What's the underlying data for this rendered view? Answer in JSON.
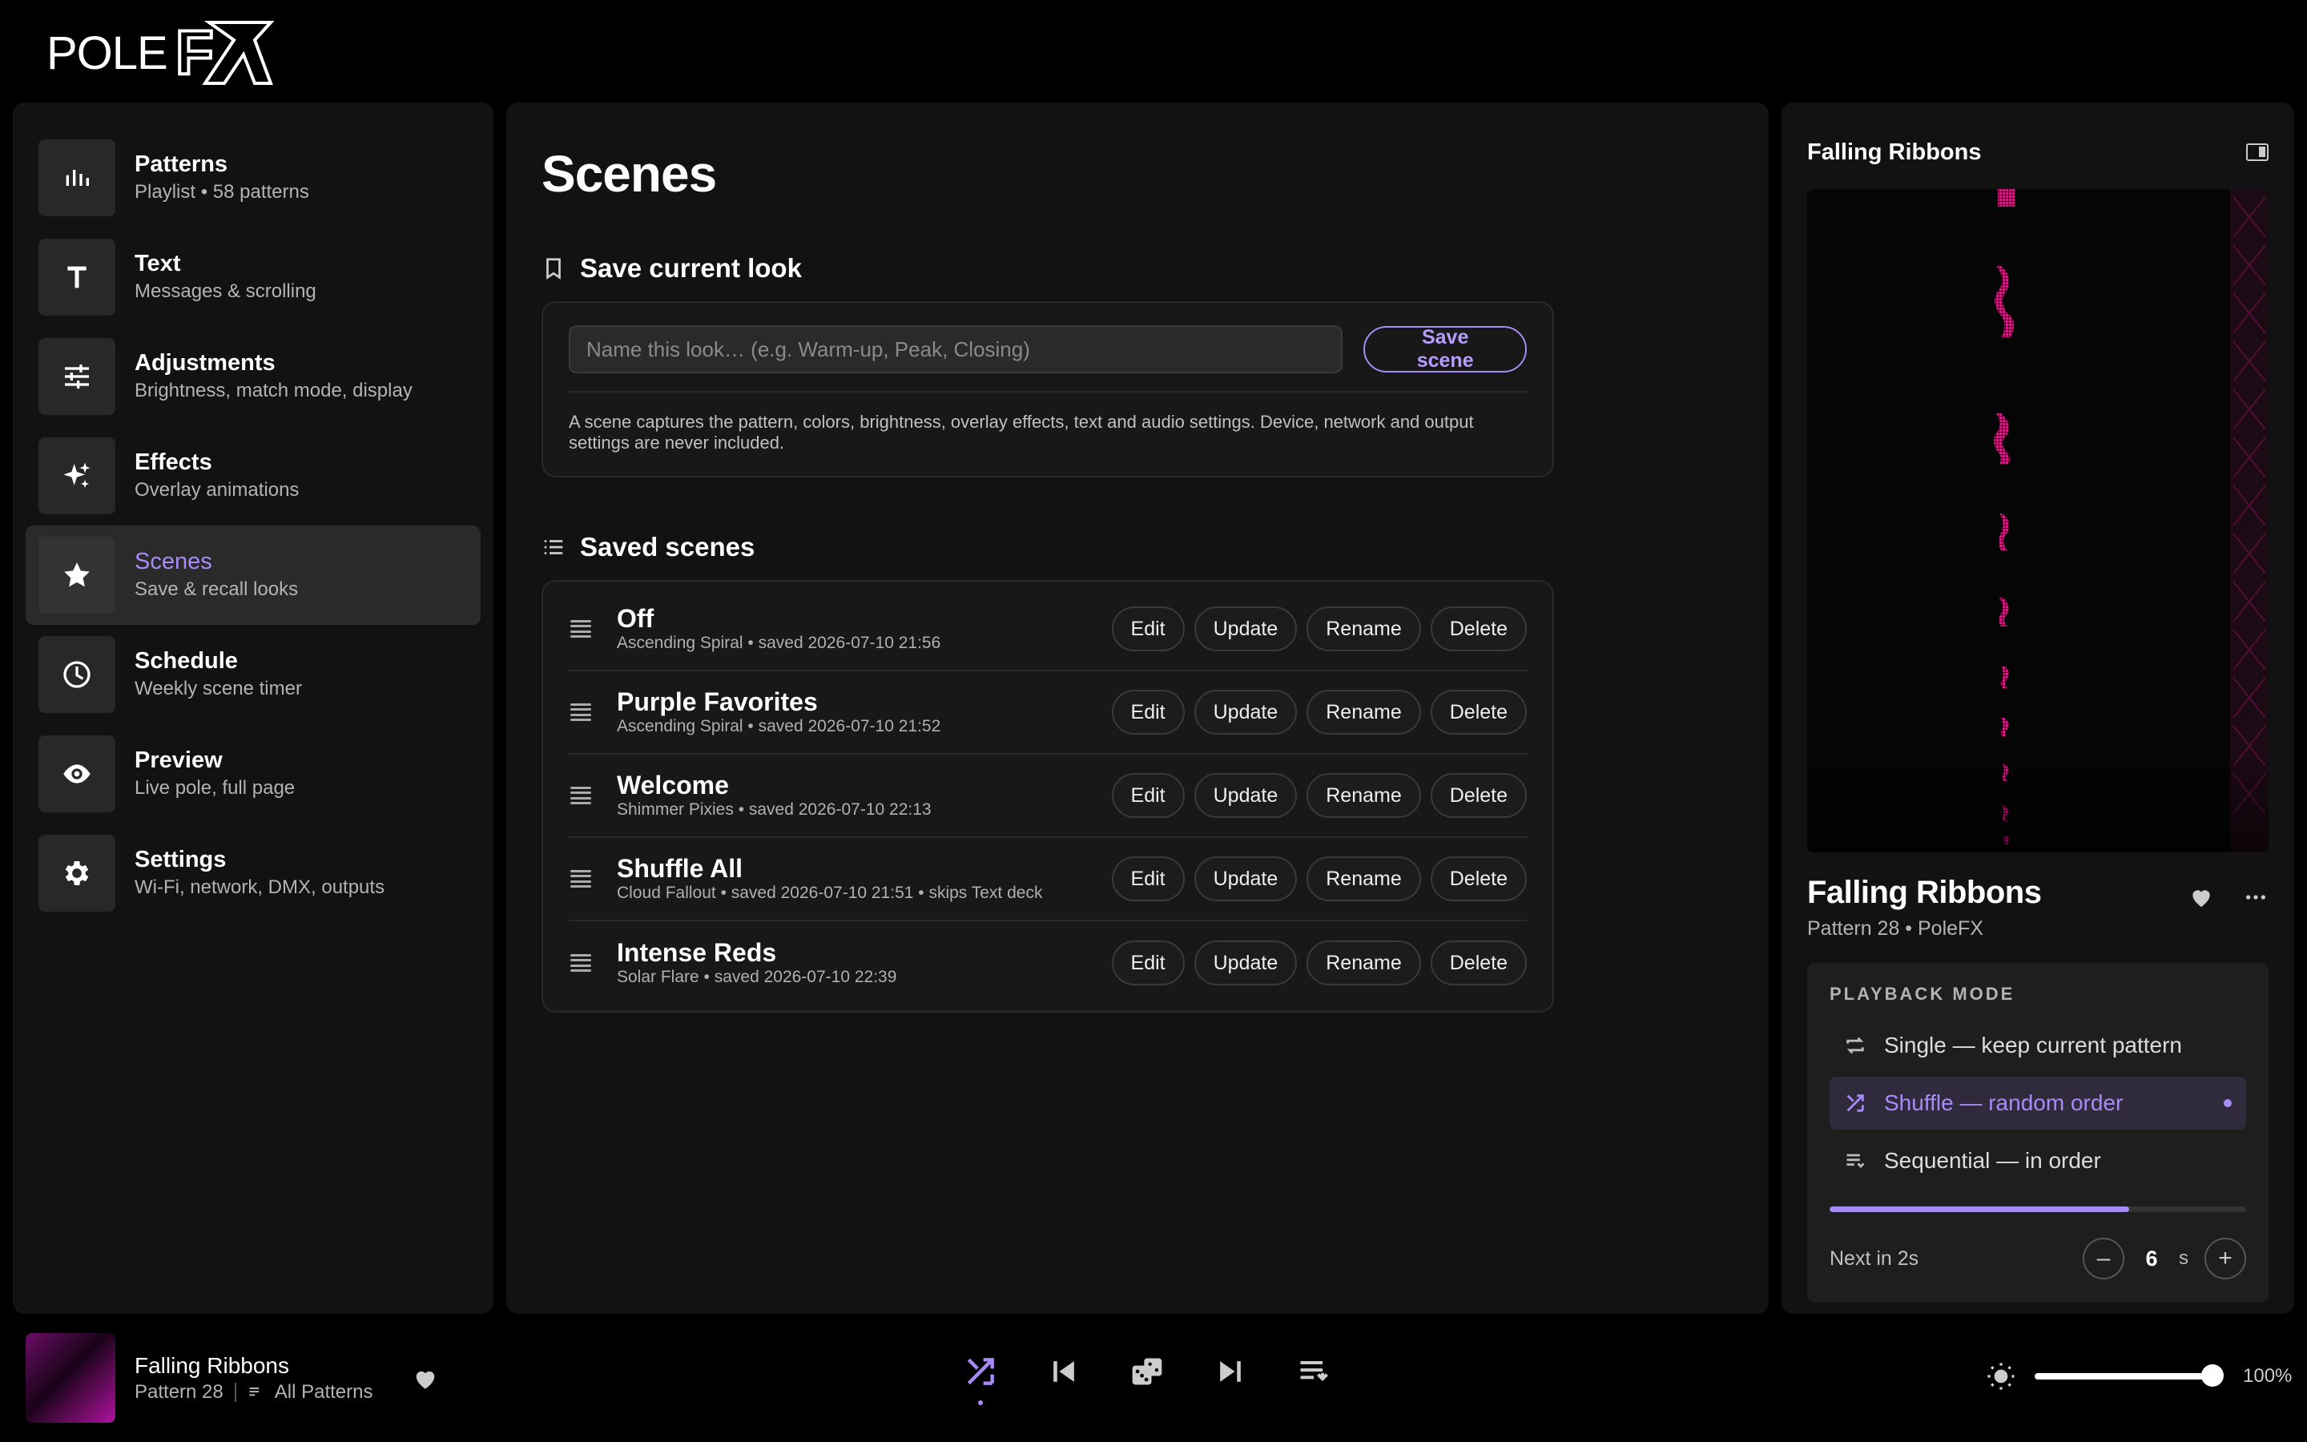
{
  "app": {
    "logo_text": "POLEFX"
  },
  "sidebar": {
    "items": [
      {
        "label": "Patterns",
        "sub": "Playlist • 58 patterns",
        "icon": "bars-icon"
      },
      {
        "label": "Text",
        "sub": "Messages & scrolling",
        "icon": "text-icon"
      },
      {
        "label": "Adjustments",
        "sub": "Brightness, match mode, display",
        "icon": "sliders-icon"
      },
      {
        "label": "Effects",
        "sub": "Overlay animations",
        "icon": "sparkle-icon"
      },
      {
        "label": "Scenes",
        "sub": "Save & recall looks",
        "icon": "star-icon",
        "active": true
      },
      {
        "label": "Schedule",
        "sub": "Weekly scene timer",
        "icon": "clock-icon"
      },
      {
        "label": "Preview",
        "sub": "Live pole, full page",
        "icon": "eye-icon"
      },
      {
        "label": "Settings",
        "sub": "Wi-Fi, network, DMX, outputs",
        "icon": "gear-icon"
      }
    ]
  },
  "main": {
    "title": "Scenes",
    "save_section": {
      "heading": "Save current look",
      "input_placeholder": "Name this look… (e.g. Warm-up, Peak, Closing)",
      "input_value": "",
      "save_label": "Save scene",
      "note": "A scene captures the pattern, colors, brightness, overlay effects, text and audio settings. Device, network and output settings are never included."
    },
    "saved_section": {
      "heading": "Saved scenes",
      "actions": [
        "Edit",
        "Update",
        "Rename",
        "Delete"
      ],
      "scenes": [
        {
          "name": "Off",
          "meta": "Ascending Spiral • saved 2026-07-10 21:56"
        },
        {
          "name": "Purple Favorites",
          "meta": "Ascending Spiral • saved 2026-07-10 21:52"
        },
        {
          "name": "Welcome",
          "meta": "Shimmer Pixies • saved 2026-07-10 22:13"
        },
        {
          "name": "Shuffle All",
          "meta": "Cloud Fallout • saved 2026-07-10 21:51 • skips Text deck"
        },
        {
          "name": "Intense Reds",
          "meta": "Solar Flare • saved 2026-07-10 22:39"
        }
      ]
    }
  },
  "right_panel": {
    "header_title": "Falling Ribbons",
    "now_playing": {
      "title": "Falling Ribbons",
      "sub": "Pattern 28 • PoleFX"
    },
    "playback": {
      "heading": "PLAYBACK MODE",
      "options": [
        {
          "label": "Single — keep current pattern",
          "icon": "repeat-icon"
        },
        {
          "label": "Shuffle — random order",
          "icon": "shuffle-icon",
          "active": true
        },
        {
          "label": "Sequential — in order",
          "icon": "list-icon"
        }
      ],
      "progress_fraction": 0.72,
      "next_label": "Next in 2s",
      "interval_value": "6",
      "interval_unit": "s",
      "minus": "–",
      "plus": "+"
    }
  },
  "bottom_bar": {
    "title": "Falling Ribbons",
    "pattern": "Pattern 28",
    "playlist": "All Patterns",
    "brightness": "100%",
    "brightness_fraction": 1.0
  },
  "colors": {
    "accent": "#a88bf5",
    "panel": "#121212",
    "preview_ribbon": "#d61e8c"
  }
}
